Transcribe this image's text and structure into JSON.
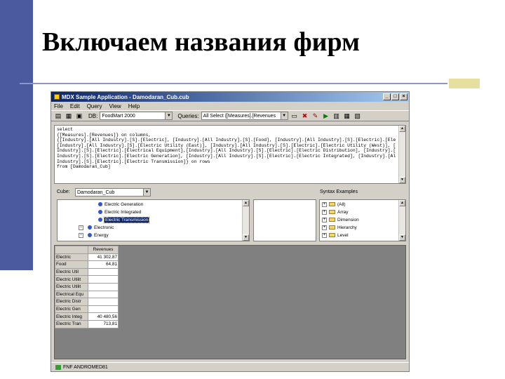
{
  "slide": {
    "title": "Включаем названия фирм"
  },
  "window": {
    "title": "MDX Sample Application - Damodaran_Cub.cub",
    "minimize": "_",
    "maximize": "□",
    "close": "×"
  },
  "menu": [
    "File",
    "Edit",
    "Query",
    "View",
    "Help"
  ],
  "toolbar": {
    "db_label": "DB:",
    "db_value": "FoodMart 2000",
    "queries_label": "Queries:",
    "queries_value": "All Select {[Measures].[Revenues"
  },
  "query_text": [
    "select",
    "{[Measures].[Revenues]} on columns,",
    "{[Industry].[All Industry].[S].[Electric], [Industry].[All Industry].[S].[Food], [Industry].[All Industry].[S].[Electric].[Electric Util (Central)],",
    "[Industry].[All Industry].[S].[Electric Utility (East)], [Industry].[All Industry].[S].[Electric].[Electric Utility (West)], [Industry].[All",
    "Industry].[S].[Electric].[Electrical Equipment],[Industry].[All Industry].[S].[Electric].[Electric Distribution], [Industry].[All",
    "Industry].[S].[Electric].[Electric Generation], [Industry].[All Industry].[S].[Electric].[Electric Integrated], [Industry].[All",
    "Industry].[S].[Electric].[Electric Transmission]} on rows",
    "from [Damodaran_Cub]"
  ],
  "cube": {
    "label": "Cube:",
    "value": "Damodaran_Cub"
  },
  "tree": [
    {
      "label": "Electric Generation",
      "selected": false,
      "level": 2
    },
    {
      "label": "Electric Integrated",
      "selected": false,
      "level": 2
    },
    {
      "label": "Electric Transmission",
      "selected": true,
      "level": 2
    },
    {
      "label": "Electronic",
      "selected": false,
      "level": 1
    },
    {
      "label": "Energy",
      "selected": false,
      "level": 1
    }
  ],
  "syntax": {
    "label": "Syntax Examples",
    "items": [
      "(All)",
      "Array",
      "Dimension",
      "Hierarchy",
      "Level"
    ]
  },
  "grid": {
    "column_header": "Revenues",
    "rows": [
      {
        "label": "Electric",
        "value": "41 302,87"
      },
      {
        "label": "Food",
        "value": "64,81"
      },
      {
        "label": "Electric Util",
        "value": ""
      },
      {
        "label": "Electric Utilit",
        "value": ""
      },
      {
        "label": "Electric Utilit",
        "value": ""
      },
      {
        "label": "Electrical Equ",
        "value": ""
      },
      {
        "label": "Electric Distr",
        "value": ""
      },
      {
        "label": "Electric Gen",
        "value": ""
      },
      {
        "label": "Electric Integ",
        "value": "40 480,56"
      },
      {
        "label": "Electric Tran",
        "value": "713,81"
      }
    ]
  },
  "status": {
    "text": "FNF ANDROMED81"
  }
}
